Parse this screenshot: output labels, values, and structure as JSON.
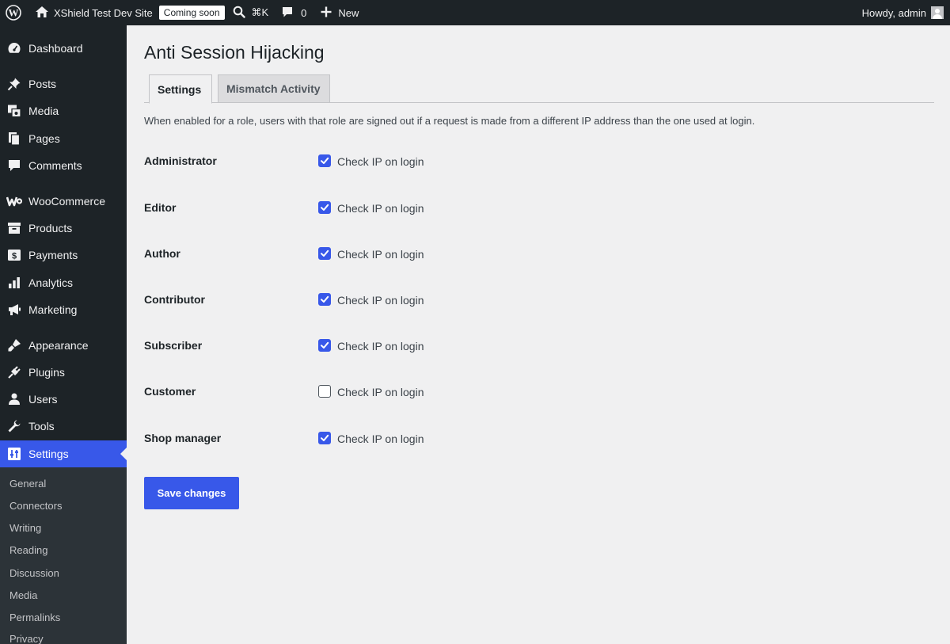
{
  "adminbar": {
    "site_name": "XShield Test Dev Site",
    "badge": "Coming soon",
    "shortcut": "⌘K",
    "comments_count": "0",
    "new_label": "New",
    "greeting": "Howdy, admin"
  },
  "sidebar": {
    "items": [
      {
        "label": "Dashboard",
        "icon": "dashboard-icon"
      },
      {
        "label": "Posts",
        "icon": "pin-icon"
      },
      {
        "label": "Media",
        "icon": "media-icon"
      },
      {
        "label": "Pages",
        "icon": "pages-icon"
      },
      {
        "label": "Comments",
        "icon": "comment-icon"
      },
      {
        "label": "WooCommerce",
        "icon": "woocommerce-icon"
      },
      {
        "label": "Products",
        "icon": "archive-icon"
      },
      {
        "label": "Payments",
        "icon": "payments-icon"
      },
      {
        "label": "Analytics",
        "icon": "bar-chart-icon"
      },
      {
        "label": "Marketing",
        "icon": "megaphone-icon"
      },
      {
        "label": "Appearance",
        "icon": "paintbrush-icon"
      },
      {
        "label": "Plugins",
        "icon": "plugin-icon"
      },
      {
        "label": "Users",
        "icon": "user-icon"
      },
      {
        "label": "Tools",
        "icon": "wrench-icon"
      },
      {
        "label": "Settings",
        "icon": "settings-icon"
      }
    ],
    "submenu": [
      "General",
      "Connectors",
      "Writing",
      "Reading",
      "Discussion",
      "Media",
      "Permalinks",
      "Privacy"
    ]
  },
  "main": {
    "title": "Anti Session Hijacking",
    "tabs": [
      {
        "label": "Settings"
      },
      {
        "label": "Mismatch Activity"
      }
    ],
    "description": "When enabled for a role, users with that role are signed out if a request is made from a different IP address than the one used at login.",
    "roles": [
      {
        "label": "Administrator",
        "option": "Check IP on login",
        "checked": true
      },
      {
        "label": "Editor",
        "option": "Check IP on login",
        "checked": true
      },
      {
        "label": "Author",
        "option": "Check IP on login",
        "checked": true
      },
      {
        "label": "Contributor",
        "option": "Check IP on login",
        "checked": true
      },
      {
        "label": "Subscriber",
        "option": "Check IP on login",
        "checked": true
      },
      {
        "label": "Customer",
        "option": "Check IP on login",
        "checked": false
      },
      {
        "label": "Shop manager",
        "option": "Check IP on login",
        "checked": true
      }
    ],
    "save_label": "Save changes"
  },
  "colors": {
    "accent": "#3858e9",
    "adminbar_bg": "#1d2327",
    "page_bg": "#f0f0f1"
  }
}
